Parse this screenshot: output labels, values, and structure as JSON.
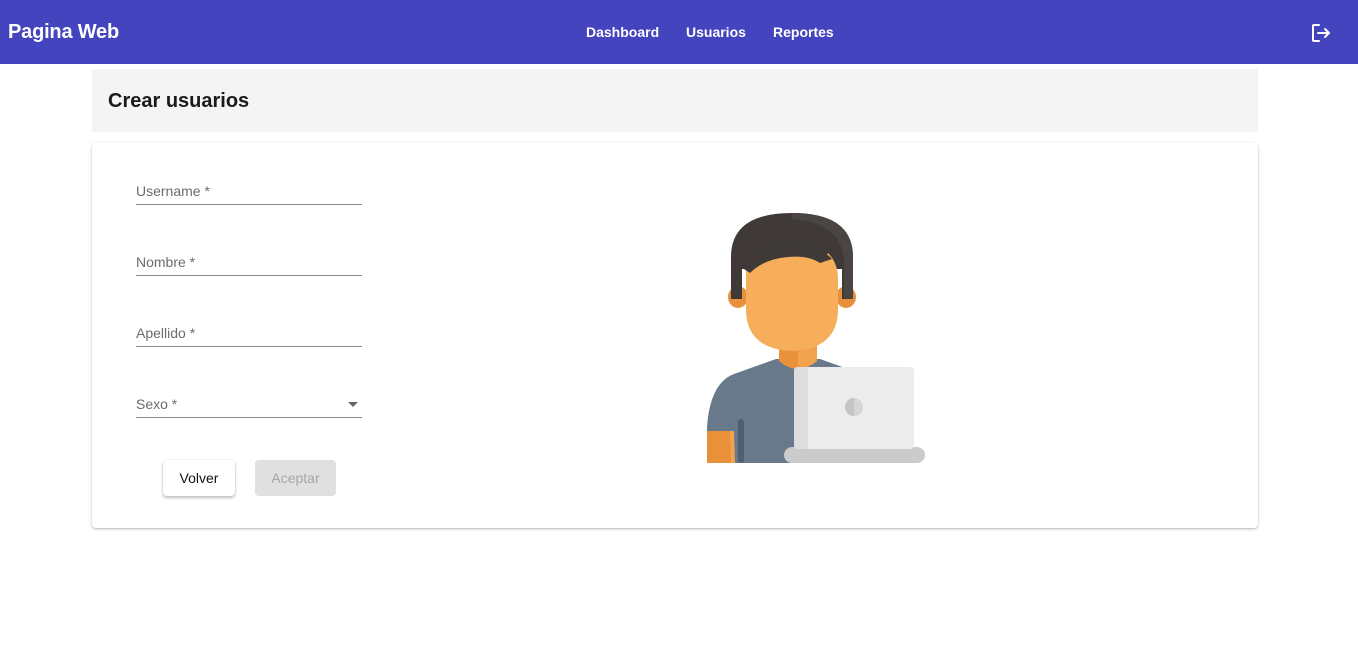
{
  "header": {
    "brand": "Pagina Web",
    "nav": [
      "Dashboard",
      "Usuarios",
      "Reportes"
    ],
    "logout_icon": "logout-icon",
    "color": "#4344be"
  },
  "page": {
    "title": "Crear usuarios"
  },
  "form": {
    "fields": [
      {
        "label": "Username *"
      },
      {
        "label": "Nombre *"
      },
      {
        "label": "Apellido *"
      },
      {
        "label": "Sexo *",
        "type": "select",
        "icon": "dropdown-arrow-icon"
      }
    ],
    "back_label": "Volver",
    "accept_label": "Aceptar"
  },
  "illustration": {
    "icon": "user-at-laptop-illustration"
  }
}
